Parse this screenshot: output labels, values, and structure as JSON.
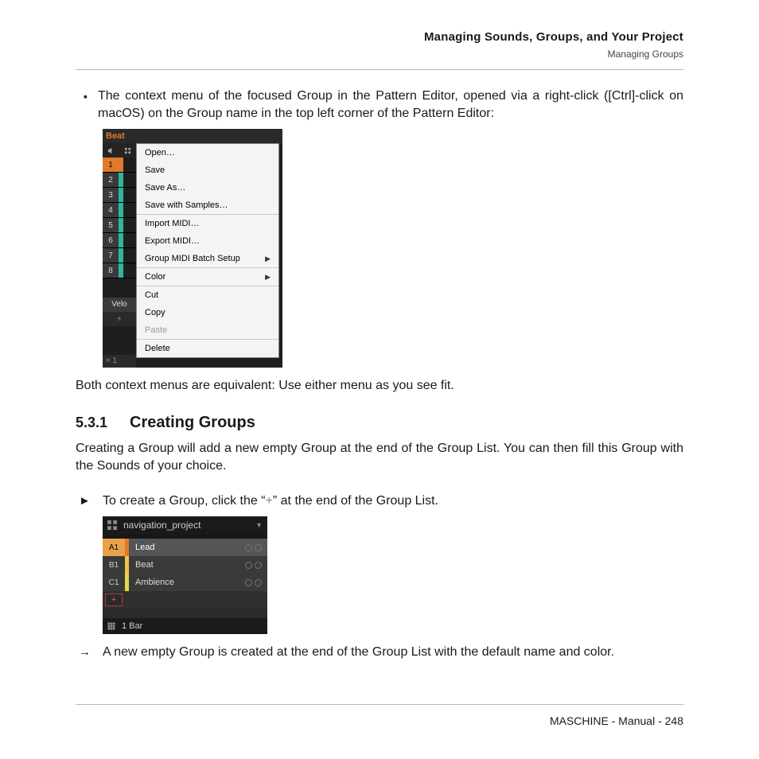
{
  "header": {
    "title": "Managing Sounds, Groups, and Your Project",
    "subtitle": "Managing Groups"
  },
  "intro_bullet": "The context menu of the focused Group in the Pattern Editor, opened via a right-click ([Ctrl]-click on macOS) on the Group name in the top left corner of the Pattern Editor:",
  "shot1": {
    "tab": "Beat",
    "rows": [
      {
        "n": "1",
        "color": "#e07a2a"
      },
      {
        "n": "2",
        "color": "#2fb5a0"
      },
      {
        "n": "3",
        "color": "#2fb5a0"
      },
      {
        "n": "4",
        "color": "#2fb5a0"
      },
      {
        "n": "5",
        "color": "#2fb5a0"
      },
      {
        "n": "6",
        "color": "#2fb5a0"
      },
      {
        "n": "7",
        "color": "#2fb5a0"
      },
      {
        "n": "8",
        "color": "#2fb5a0"
      }
    ],
    "velocity_label": "Velo",
    "plus": "+",
    "foot": "⌗  1",
    "menu": [
      {
        "label": "Open…",
        "sepAfter": false
      },
      {
        "label": "Save",
        "sepAfter": false
      },
      {
        "label": "Save As…",
        "sepAfter": false
      },
      {
        "label": "Save with Samples…",
        "sepAfter": true
      },
      {
        "label": "Import MIDI…",
        "sepAfter": false
      },
      {
        "label": "Export MIDI…",
        "sepAfter": false
      },
      {
        "label": "Group MIDI Batch Setup",
        "arrow": true,
        "sepAfter": true
      },
      {
        "label": "Color",
        "arrow": true,
        "sepAfter": true
      },
      {
        "label": "Cut",
        "sepAfter": false
      },
      {
        "label": "Copy",
        "sepAfter": false
      },
      {
        "label": "Paste",
        "disabled": true,
        "sepAfter": true
      },
      {
        "label": "Delete",
        "sepAfter": false
      }
    ]
  },
  "equivalent_note": "Both context menus are equivalent: Use either menu as you see fit.",
  "section": {
    "number": "5.3.1",
    "title": "Creating Groups"
  },
  "section_intro": "Creating a Group will add a new empty Group at the end of the Group List. You can then fill this Group with the Sounds of your choice.",
  "step_prefix": "To create a Group, click the “",
  "step_plus": "+",
  "step_suffix": "” at the end of the Group List.",
  "shot2": {
    "title": "navigation_project",
    "rows": [
      {
        "id": "A1",
        "idbg": "#e9a24a",
        "bar": "#e07a2a",
        "name": "Lead"
      },
      {
        "id": "B1",
        "idbg": "#3a3a3a",
        "bar": "#e9c64a",
        "name": "Beat"
      },
      {
        "id": "C1",
        "idbg": "#3a3a3a",
        "bar": "#e2d84a",
        "name": "Ambience"
      }
    ],
    "add": "+",
    "footer": "1 Bar"
  },
  "result_text": "A new empty Group is created at the end of the Group List with the default name and color.",
  "footer": "MASCHINE - Manual - 248"
}
